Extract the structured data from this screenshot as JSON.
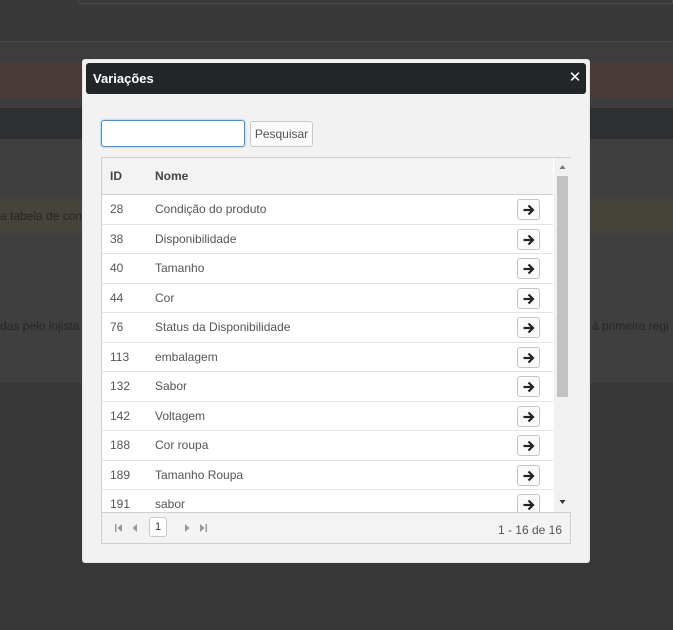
{
  "background": {
    "text_left_1": "a tabela de con",
    "text_left_2": "das pelo lojista",
    "text_right_1": "á primeira regi"
  },
  "dialog": {
    "title": "Variações",
    "close_glyph": "✕",
    "close_icon": "close-icon"
  },
  "search": {
    "value": "",
    "placeholder": "",
    "button_label": "Pesquisar"
  },
  "grid": {
    "columns": [
      "ID",
      "Nome"
    ],
    "rows": [
      {
        "id": "28",
        "name": "Condição do produto"
      },
      {
        "id": "38",
        "name": "Disponibilidade"
      },
      {
        "id": "40",
        "name": "Tamanho"
      },
      {
        "id": "44",
        "name": "Cor"
      },
      {
        "id": "76",
        "name": "Status da Disponibilidade"
      },
      {
        "id": "113",
        "name": "embalagem"
      },
      {
        "id": "132",
        "name": "Sabor"
      },
      {
        "id": "142",
        "name": "Voltagem"
      },
      {
        "id": "188",
        "name": "Cor roupa"
      },
      {
        "id": "189",
        "name": "Tamanho Roupa"
      },
      {
        "id": "191",
        "name": "sabor"
      }
    ],
    "row_action_icon": "arrow-right-icon"
  },
  "pager": {
    "current_page": "1",
    "info": "1 - 16 de 16"
  },
  "colors": {
    "header_bg": "#222628",
    "accent_focus": "#4d90c9"
  }
}
